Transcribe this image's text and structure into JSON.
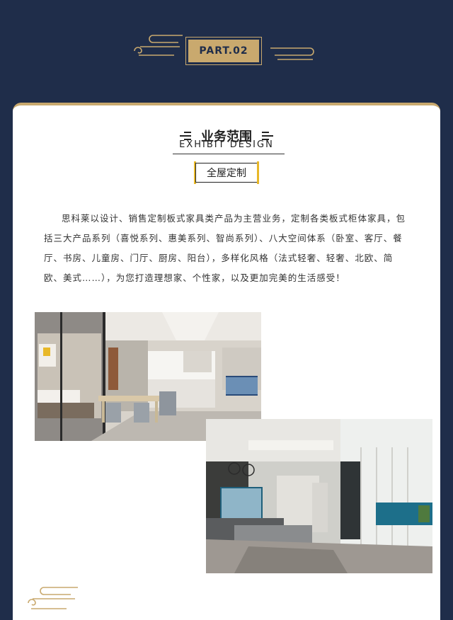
{
  "header": {
    "part_label": "PART.02"
  },
  "card": {
    "title": "业务范围",
    "subtitle": "EXHIBIT DESIGN",
    "badge": "全屋定制",
    "description": "思科莱以设计、销售定制板式家具类产品为主营业务，定制各类板式柜体家具，包括三大产品系列（喜悦系列、惠美系列、智尚系列）、八大空间体系（卧室、客厅、餐厅、书房、儿童房、门厅、厨房、阳台），多样化风格（法式轻奢、轻奢、北欧、简欧、美式……），为您打造理想家、个性家，以及更加完美的生活感受！"
  },
  "colors": {
    "navy": "#1f2d4a",
    "gold": "#c9a96e",
    "accent_yellow": "#e8b828",
    "card_bg": "#ffffff"
  },
  "icons": {
    "left_cloud": "cloud-scroll-icon",
    "right_cloud": "cloud-scroll-icon",
    "title_lines": "triple-lines-icon",
    "footer_cloud": "cloud-scroll-icon"
  }
}
